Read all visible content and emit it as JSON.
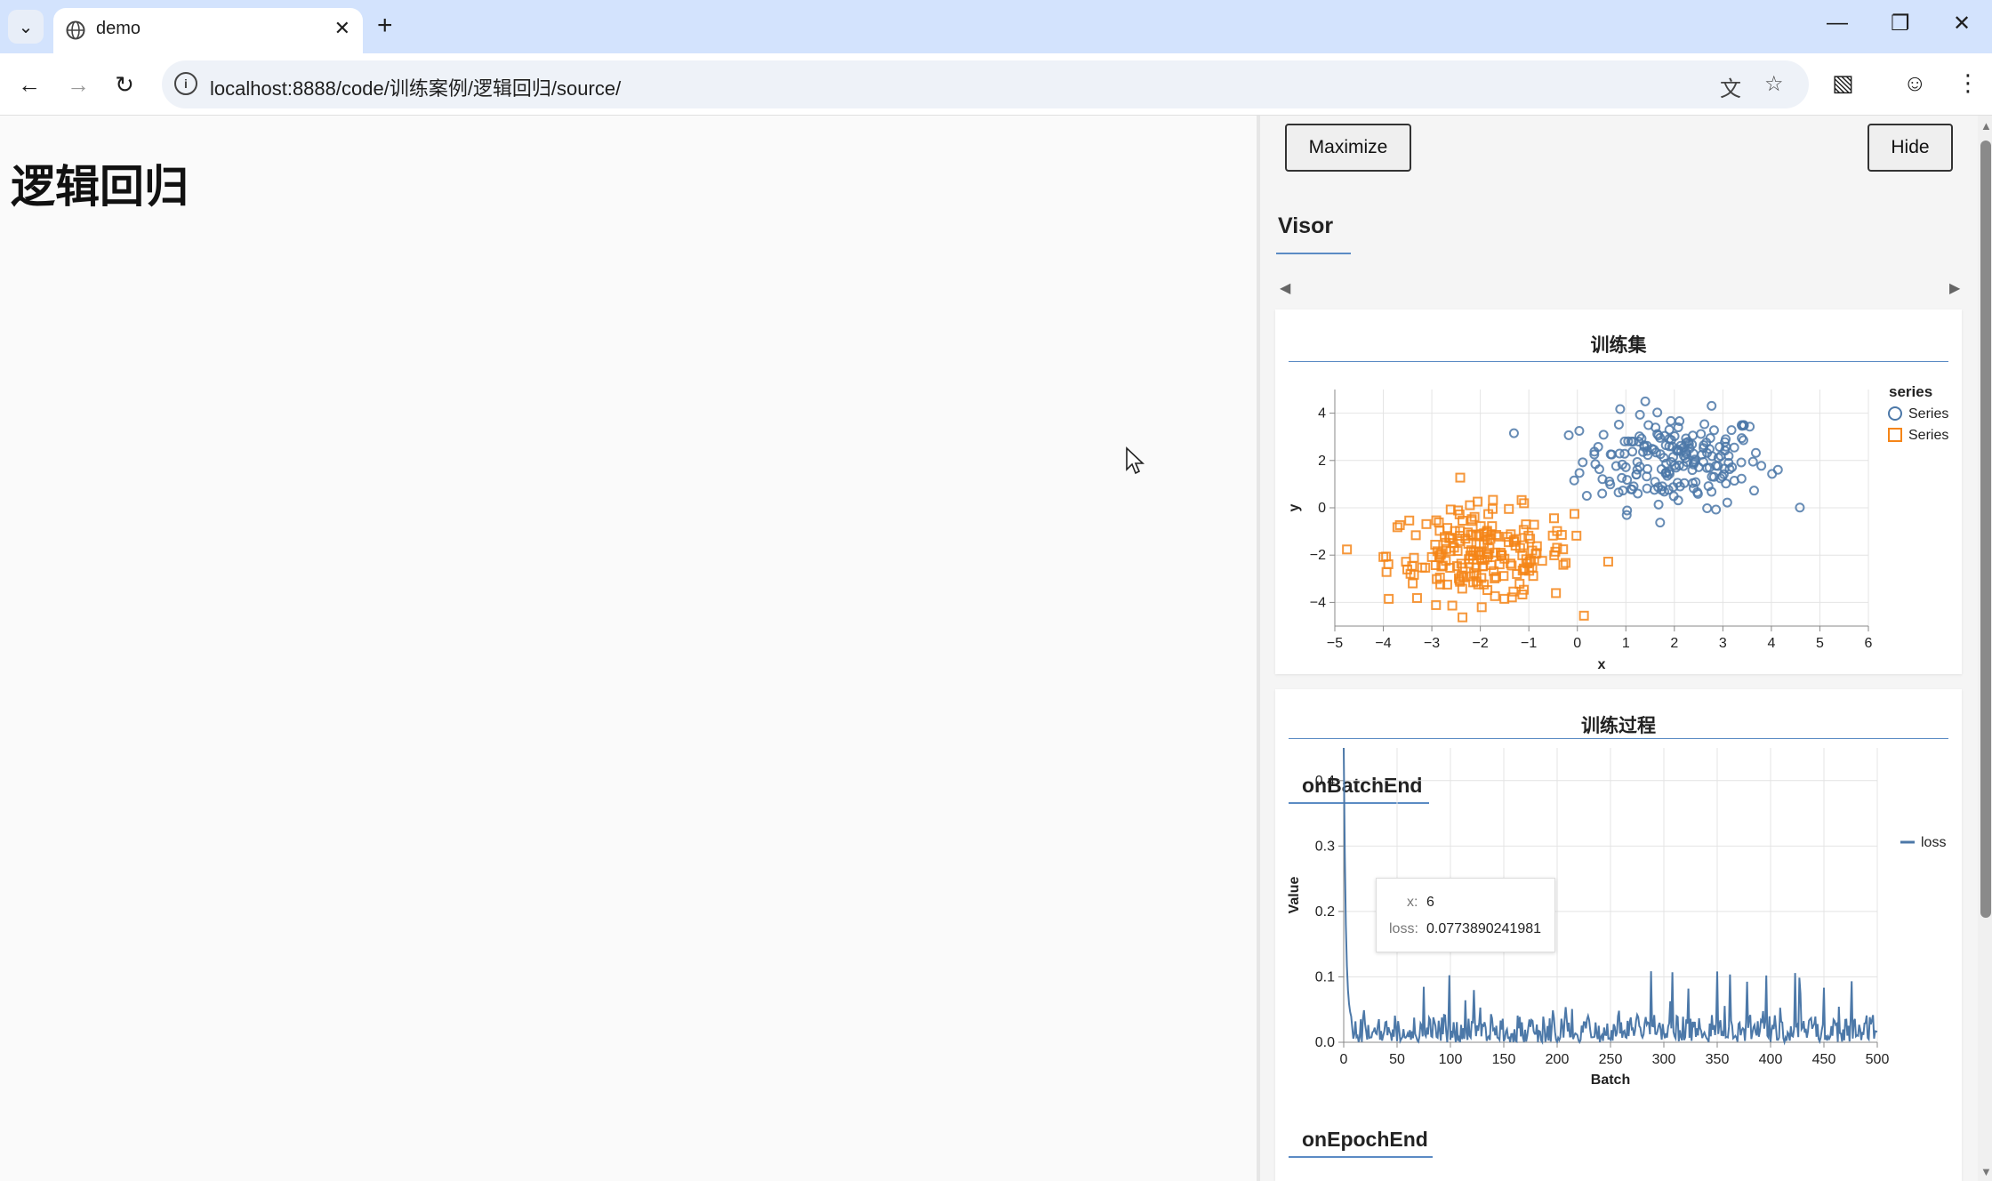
{
  "browser": {
    "tab_title": "demo",
    "url": "localhost:8888/code/训练案例/逻辑回归/source/"
  },
  "page": {
    "heading": "逻辑回归"
  },
  "visor": {
    "maximize_label": "Maximize",
    "hide_label": "Hide",
    "tab_label": "Visor",
    "scatter_card_title": "训练集",
    "process_card_title": "训练过程",
    "batch_section": "onBatchEnd",
    "epoch_section": "onEpochEnd",
    "tooltip": {
      "x_label": "x:",
      "x_value": "6",
      "loss_label": "loss:",
      "loss_value": "0.0773890241981"
    }
  },
  "chart_data": [
    {
      "type": "scatter",
      "title": "训练集",
      "xlabel": "x",
      "ylabel": "y",
      "xlim": [
        -5,
        6
      ],
      "ylim": [
        -5,
        5
      ],
      "x_ticks": [
        -5,
        -4,
        -3,
        -2,
        -1,
        0,
        1,
        2,
        3,
        4,
        5,
        6
      ],
      "y_ticks": [
        4,
        2,
        0,
        -2,
        -4
      ],
      "legend_title": "series",
      "legend_position": "right",
      "grid": true,
      "series": [
        {
          "name": "Series",
          "marker": "circle",
          "color": "#4c78a8",
          "center": [
            2,
            2
          ],
          "count": 200
        },
        {
          "name": "Series",
          "marker": "square",
          "color": "#f58518",
          "center": [
            -2,
            -2
          ],
          "count": 200
        }
      ]
    },
    {
      "type": "line",
      "xlabel": "Batch",
      "ylabel": "Value",
      "xlim": [
        0,
        500
      ],
      "ylim": [
        0,
        0.45
      ],
      "x_ticks": [
        0,
        50,
        100,
        150,
        200,
        250,
        300,
        350,
        400,
        450,
        500
      ],
      "y_ticks": [
        0.0,
        0.1,
        0.2,
        0.3,
        0.4
      ],
      "y_tick_labels": [
        "0.0",
        "0.1",
        "0.2",
        "0.3",
        "0.4"
      ],
      "legend_position": "top-right",
      "grid": true,
      "series": [
        {
          "name": "loss",
          "color": "#4c78a8",
          "initial": 0.45,
          "baseline": 0.03,
          "spike_max": 0.11
        }
      ]
    }
  ]
}
